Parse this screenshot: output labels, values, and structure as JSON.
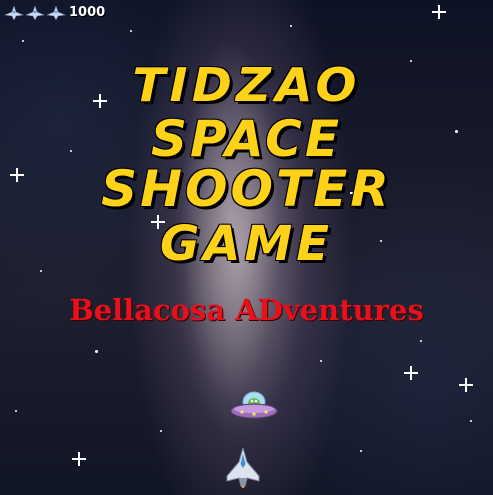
{
  "hud": {
    "lives": 3,
    "score": "1000"
  },
  "title": {
    "line1": "TIDZAO",
    "line2": "SPACE SHOOTER",
    "line3": "GAME"
  },
  "subtitle": "Bellacosa ADventures",
  "sprites": {
    "enemy": "ufo-icon",
    "player": "player-ship-icon",
    "life": "life-ship-icon"
  },
  "colors": {
    "title": "#ffd21a",
    "subtitle": "#e8101a",
    "score": "#ffffff"
  }
}
